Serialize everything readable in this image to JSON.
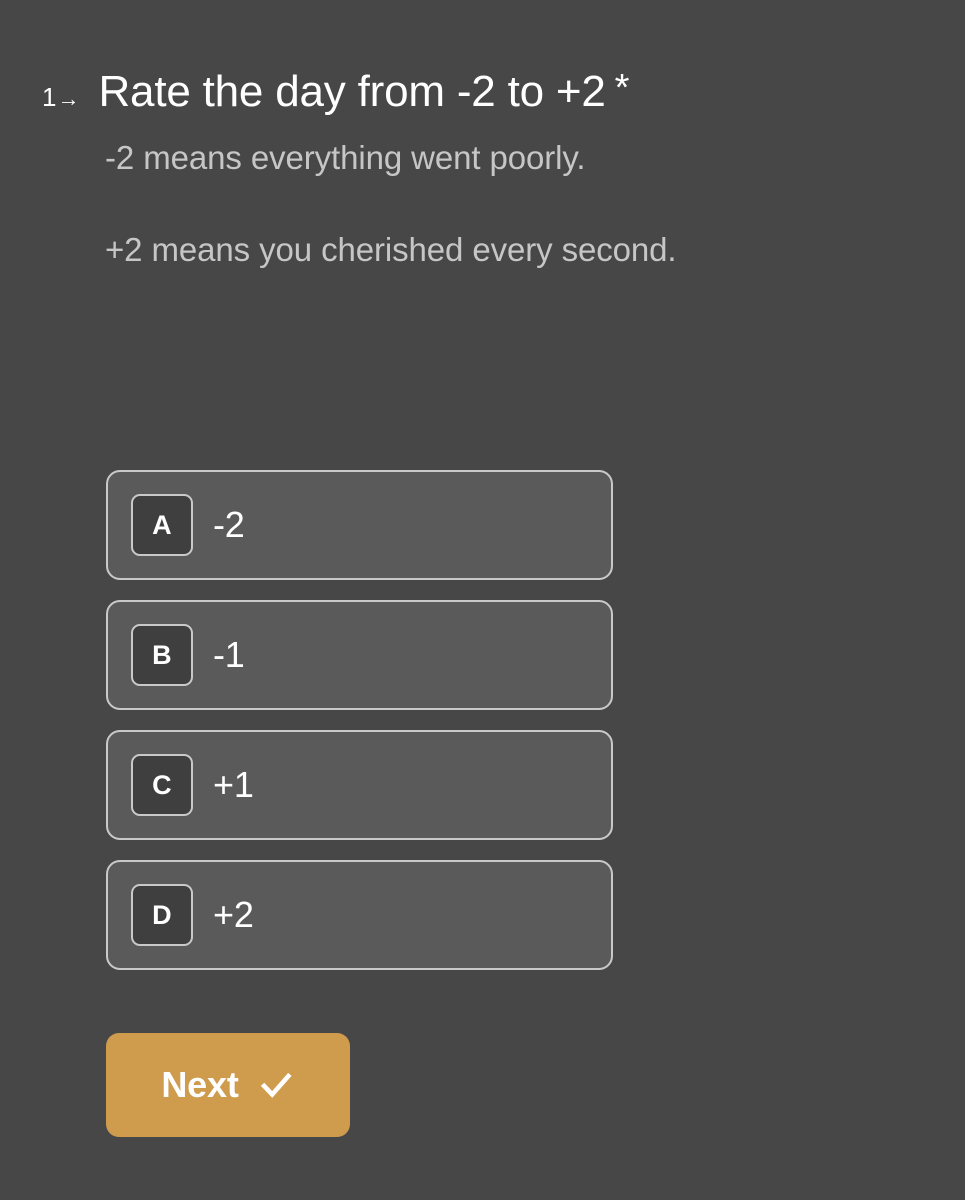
{
  "theme": {
    "background": "#474747",
    "option_fill": "#5a5a5a",
    "option_border": "#c9c9c9",
    "key_badge_fill": "#3f3f3f",
    "accent": "#cf9c4e",
    "heading_text": "#ffffff",
    "description_text": "#c6c6c6"
  },
  "question": {
    "index": "1",
    "index_arrow": "→",
    "title": "Rate the day from ‑2 to +2",
    "required_marker": "*",
    "description_paragraphs": [
      "‑2 means everything went poorly.",
      "+2 means you cherished every second."
    ]
  },
  "options": [
    {
      "key": "A",
      "label": "‑2"
    },
    {
      "key": "B",
      "label": "‑1"
    },
    {
      "key": "C",
      "label": "+1"
    },
    {
      "key": "D",
      "label": "+2"
    }
  ],
  "actions": {
    "next_label": "Next",
    "next_icon": "check-icon"
  }
}
